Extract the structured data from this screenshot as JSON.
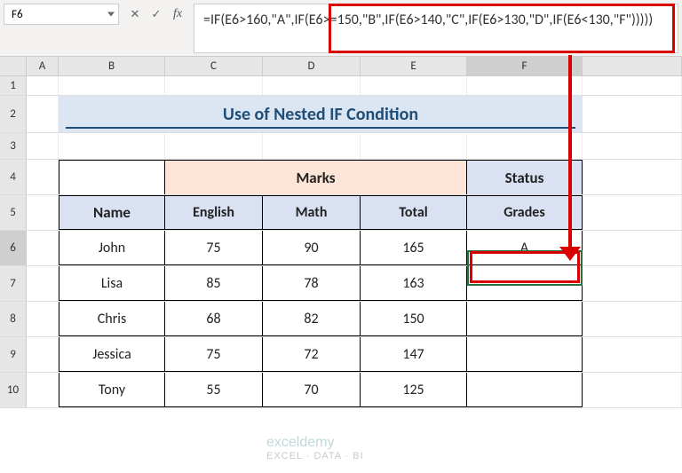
{
  "nameBox": "F6",
  "formula": "=IF(E6>160,\"A\",IF(E6>=150,\"B\",IF(E6>140,\"C\",IF(E6>130,\"D\",IF(E6<130,\"F\")))))",
  "columns": [
    "A",
    "B",
    "C",
    "D",
    "E",
    "F"
  ],
  "rows": [
    "1",
    "2",
    "3",
    "4",
    "5",
    "6",
    "7",
    "8",
    "9",
    "10"
  ],
  "title": "Use of Nested IF Condition",
  "headers": {
    "marks": "Marks",
    "status": "Status",
    "name": "Name",
    "english": "English",
    "math": "Math",
    "total": "Total",
    "grades": "Grades"
  },
  "people": [
    {
      "name": "John",
      "english": "75",
      "math": "90",
      "total": "165",
      "grade": "A"
    },
    {
      "name": "Lisa",
      "english": "85",
      "math": "78",
      "total": "163",
      "grade": ""
    },
    {
      "name": "Chris",
      "english": "68",
      "math": "82",
      "total": "150",
      "grade": ""
    },
    {
      "name": "Jessica",
      "english": "75",
      "math": "72",
      "total": "147",
      "grade": ""
    },
    {
      "name": "Tony",
      "english": "55",
      "math": "70",
      "total": "125",
      "grade": ""
    }
  ],
  "watermark": {
    "main": "exceldemy",
    "sub": "EXCEL · DATA · BI"
  },
  "chart_data": {
    "type": "table",
    "title": "Use of Nested IF Condition",
    "columns": [
      "Name",
      "English",
      "Math",
      "Total",
      "Grades"
    ],
    "rows": [
      [
        "John",
        75,
        90,
        165,
        "A"
      ],
      [
        "Lisa",
        85,
        78,
        163,
        null
      ],
      [
        "Chris",
        68,
        82,
        150,
        null
      ],
      [
        "Jessica",
        75,
        72,
        147,
        null
      ],
      [
        "Tony",
        55,
        70,
        125,
        null
      ]
    ]
  }
}
